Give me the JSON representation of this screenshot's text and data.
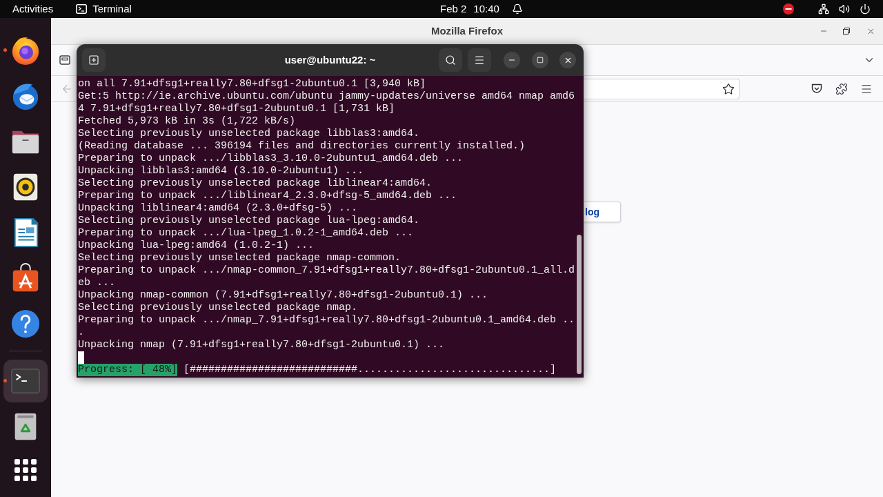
{
  "top_bar": {
    "activities": "Activities",
    "app_menu": "Terminal",
    "date": "Feb 2",
    "time": "10:40"
  },
  "dock": {
    "items": [
      {
        "kind": "browser",
        "running": true,
        "selected": false,
        "separator_before": false
      },
      {
        "kind": "mail",
        "running": false,
        "selected": false,
        "separator_before": false
      },
      {
        "kind": "files",
        "running": false,
        "selected": false,
        "separator_before": false
      },
      {
        "kind": "music",
        "running": false,
        "selected": false,
        "separator_before": false
      },
      {
        "kind": "writer",
        "running": false,
        "selected": false,
        "separator_before": false
      },
      {
        "kind": "store",
        "running": false,
        "selected": false,
        "separator_before": false
      },
      {
        "kind": "help",
        "running": false,
        "selected": false,
        "separator_before": false
      },
      {
        "kind": "terminal",
        "running": true,
        "selected": true,
        "separator_before": true
      },
      {
        "kind": "trash",
        "running": false,
        "selected": false,
        "separator_before": false
      }
    ]
  },
  "browser": {
    "title": "Mozilla Firefox",
    "back_disabled": true,
    "page_button": "log"
  },
  "terminal": {
    "title": "user@ubuntu22: ~",
    "lines": [
      "on all 7.91+dfsg1+really7.80+dfsg1-2ubuntu0.1 [3,940 kB]",
      "Get:5 http://ie.archive.ubuntu.com/ubuntu jammy-updates/universe amd64 nmap amd6",
      "4 7.91+dfsg1+really7.80+dfsg1-2ubuntu0.1 [1,731 kB]",
      "Fetched 5,973 kB in 3s (1,722 kB/s)",
      "Selecting previously unselected package libblas3:amd64.",
      "(Reading database ... 396194 files and directories currently installed.)",
      "Preparing to unpack .../libblas3_3.10.0-2ubuntu1_amd64.deb ...",
      "Unpacking libblas3:amd64 (3.10.0-2ubuntu1) ...",
      "Selecting previously unselected package liblinear4:amd64.",
      "Preparing to unpack .../liblinear4_2.3.0+dfsg-5_amd64.deb ...",
      "Unpacking liblinear4:amd64 (2.3.0+dfsg-5) ...",
      "Selecting previously unselected package lua-lpeg:amd64.",
      "Preparing to unpack .../lua-lpeg_1.0.2-1_amd64.deb ...",
      "Unpacking lua-lpeg:amd64 (1.0.2-1) ...",
      "Selecting previously unselected package nmap-common.",
      "Preparing to unpack .../nmap-common_7.91+dfsg1+really7.80+dfsg1-2ubuntu0.1_all.d",
      "eb ...",
      "Unpacking nmap-common (7.91+dfsg1+really7.80+dfsg1-2ubuntu0.1) ...",
      "Selecting previously unselected package nmap.",
      "Preparing to unpack .../nmap_7.91+dfsg1+really7.80+dfsg1-2ubuntu0.1_amd64.deb ..",
      ".",
      "Unpacking nmap (7.91+dfsg1+really7.80+dfsg1-2ubuntu0.1) ..."
    ],
    "progress_label": "Progress: [ 48%]",
    "progress_bar": "[###########################...............................]"
  }
}
